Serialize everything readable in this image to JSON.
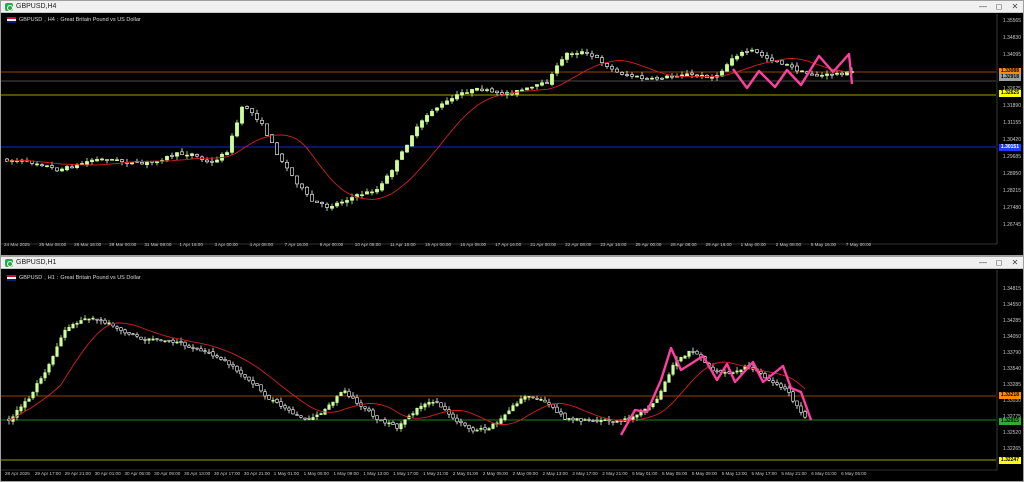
{
  "windows": [
    {
      "id": "h4",
      "title": "GBPUSD,H4",
      "symbol": "GBPUSD",
      "timeframe": "H4",
      "description": "Great Britain Pound vs US Dollar",
      "price_axis": [
        "1.35565",
        "1.34830",
        "1.34095",
        "1.33360",
        "1.32625",
        "1.31890",
        "1.31155",
        "1.30420",
        "1.29685",
        "1.28950",
        "1.28215",
        "1.27480",
        "1.26745"
      ],
      "time_axis": [
        "24 Mar 2025",
        "25 Mar 08:00",
        "26 Mar 16:00",
        "28 Mar 00:00",
        "31 Mar 08:00",
        "1 Apr 16:00",
        "3 Apr 00:00",
        "4 Apr 08:00",
        "7 Apr 16:00",
        "9 Apr 00:00",
        "10 Apr 08:00",
        "11 Apr 16:00",
        "15 Apr 00:00",
        "16 Apr 08:00",
        "17 Apr 16:00",
        "21 Apr 00:00",
        "22 Apr 08:00",
        "23 Apr 16:00",
        "25 Apr 00:00",
        "28 Apr 08:00",
        "29 Apr 16:00",
        "1 May 00:00",
        "2 May 08:00",
        "5 May 16:00",
        "7 May 00:00"
      ],
      "price_tags": [
        {
          "label": "1.33088",
          "bg": "#ff8c00",
          "fg": "#000000"
        },
        {
          "label": "1.32918",
          "bg": "#a0a0a0",
          "fg": "#000000"
        },
        {
          "label": "1.32625",
          "bg": "#ffff00",
          "fg": "#000000"
        },
        {
          "label": "1.30151",
          "bg": "#1e3cff",
          "fg": "#ffffff"
        }
      ]
    },
    {
      "id": "h1",
      "title": "GBPUSD,H1",
      "symbol": "GBPUSD",
      "timeframe": "H1",
      "description": "Great Britain Pound vs US Dollar",
      "price_axis": [
        "1.34815",
        "1.34550",
        "1.34285",
        "1.34050",
        "1.33790",
        "1.33540",
        "1.33285",
        "1.33030",
        "1.32775",
        "1.32520",
        "1.32265"
      ],
      "time_axis": [
        "28 Apr 2025",
        "29 Apr 17:00",
        "29 Apr 21:00",
        "30 Apr 01:00",
        "30 Apr 05:00",
        "30 Apr 09:00",
        "30 Apr 13:00",
        "30 Apr 17:00",
        "30 Apr 21:00",
        "1 May 01:00",
        "1 May 05:00",
        "1 May 09:00",
        "1 May 13:00",
        "1 May 17:00",
        "1 May 21:00",
        "2 May 01:00",
        "2 May 05:00",
        "2 May 09:00",
        "2 May 13:00",
        "2 May 17:00",
        "2 May 21:00",
        "5 May 01:00",
        "5 May 05:00",
        "5 May 09:00",
        "5 May 13:00",
        "5 May 17:00",
        "5 May 21:00",
        "6 May 01:00",
        "6 May 05:00"
      ],
      "price_tags": [
        {
          "label": "1.33218",
          "bg": "#ff8c00",
          "fg": "#000000"
        },
        {
          "label": "1.32915",
          "bg": "#33aa33",
          "fg": "#000000"
        },
        {
          "label": "1.32247",
          "bg": "#ffff00",
          "fg": "#000000"
        }
      ]
    }
  ],
  "colors": {
    "background": "#000000",
    "bull_candle": "#ccff99",
    "bear_candle": "#ffffff",
    "moving_average": "#d62020",
    "zigzag": "#ff3fa0",
    "axis_text": "#c8c8c8",
    "level_orange": "#c65a00",
    "level_yellow": "#d7d700",
    "level_blue": "#1e3cff",
    "level_green": "#33aa33"
  },
  "icons": {
    "app": "chart-app-icon",
    "minimize": "minimize-icon",
    "maximize": "maximize-icon",
    "close": "close-icon",
    "flag": "gbp-flag-icon"
  }
}
